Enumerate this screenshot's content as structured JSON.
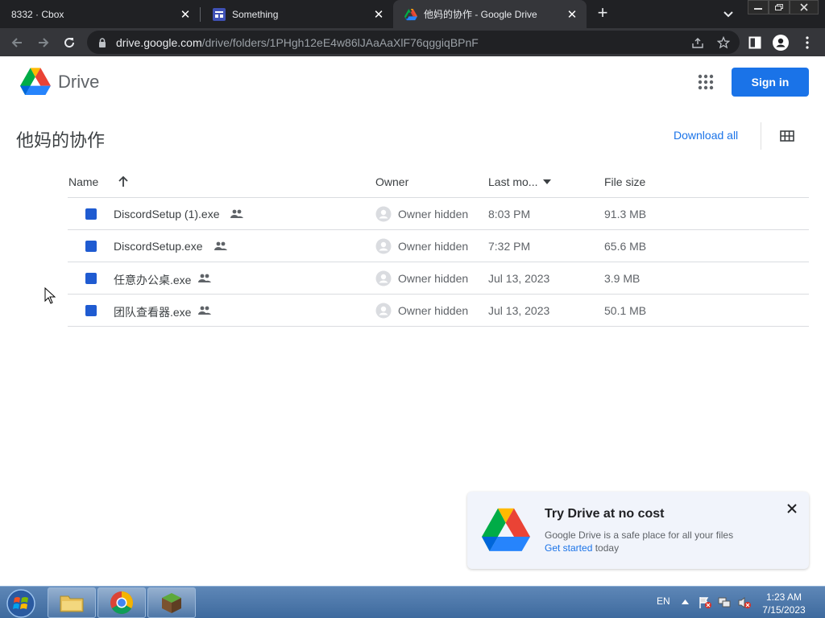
{
  "browser": {
    "tabs": [
      {
        "title": "8332 · Cbox"
      },
      {
        "title": "Something"
      },
      {
        "title": "他妈的协作 - Google Drive"
      }
    ],
    "url_host": "drive.google.com",
    "url_path": "/drive/folders/1PHgh12eE4w86lJAaAaXlF76qggiqBPnF"
  },
  "drive": {
    "brand": "Drive",
    "sign_in_label": "Sign in",
    "folder_title": "他妈的协作",
    "download_all_label": "Download all"
  },
  "list": {
    "columns": {
      "name": "Name",
      "owner": "Owner",
      "last_modified": "Last mo...",
      "file_size": "File size"
    },
    "rows": [
      {
        "name": "DiscordSetup (1).exe",
        "owner": "Owner hidden",
        "modified": "8:03 PM",
        "size": "91.3 MB"
      },
      {
        "name": "DiscordSetup.exe",
        "owner": "Owner hidden",
        "modified": "7:32 PM",
        "size": "65.6 MB"
      },
      {
        "name": "任意办公桌.exe",
        "owner": "Owner hidden",
        "modified": "Jul 13, 2023",
        "size": "3.9 MB"
      },
      {
        "name": "团队查看器.exe",
        "owner": "Owner hidden",
        "modified": "Jul 13, 2023",
        "size": "50.1 MB"
      }
    ]
  },
  "promo": {
    "title": "Try Drive at no cost",
    "body": "Google Drive is a safe place for all your files",
    "link": "Get started",
    "suffix": " today"
  },
  "taskbar": {
    "language": "EN",
    "time": "1:23 AM",
    "date": "7/15/2023"
  },
  "colors": {
    "accent": "#1a73e8",
    "chrome_dark": "#202124",
    "chrome_toolbar": "#35363a"
  }
}
